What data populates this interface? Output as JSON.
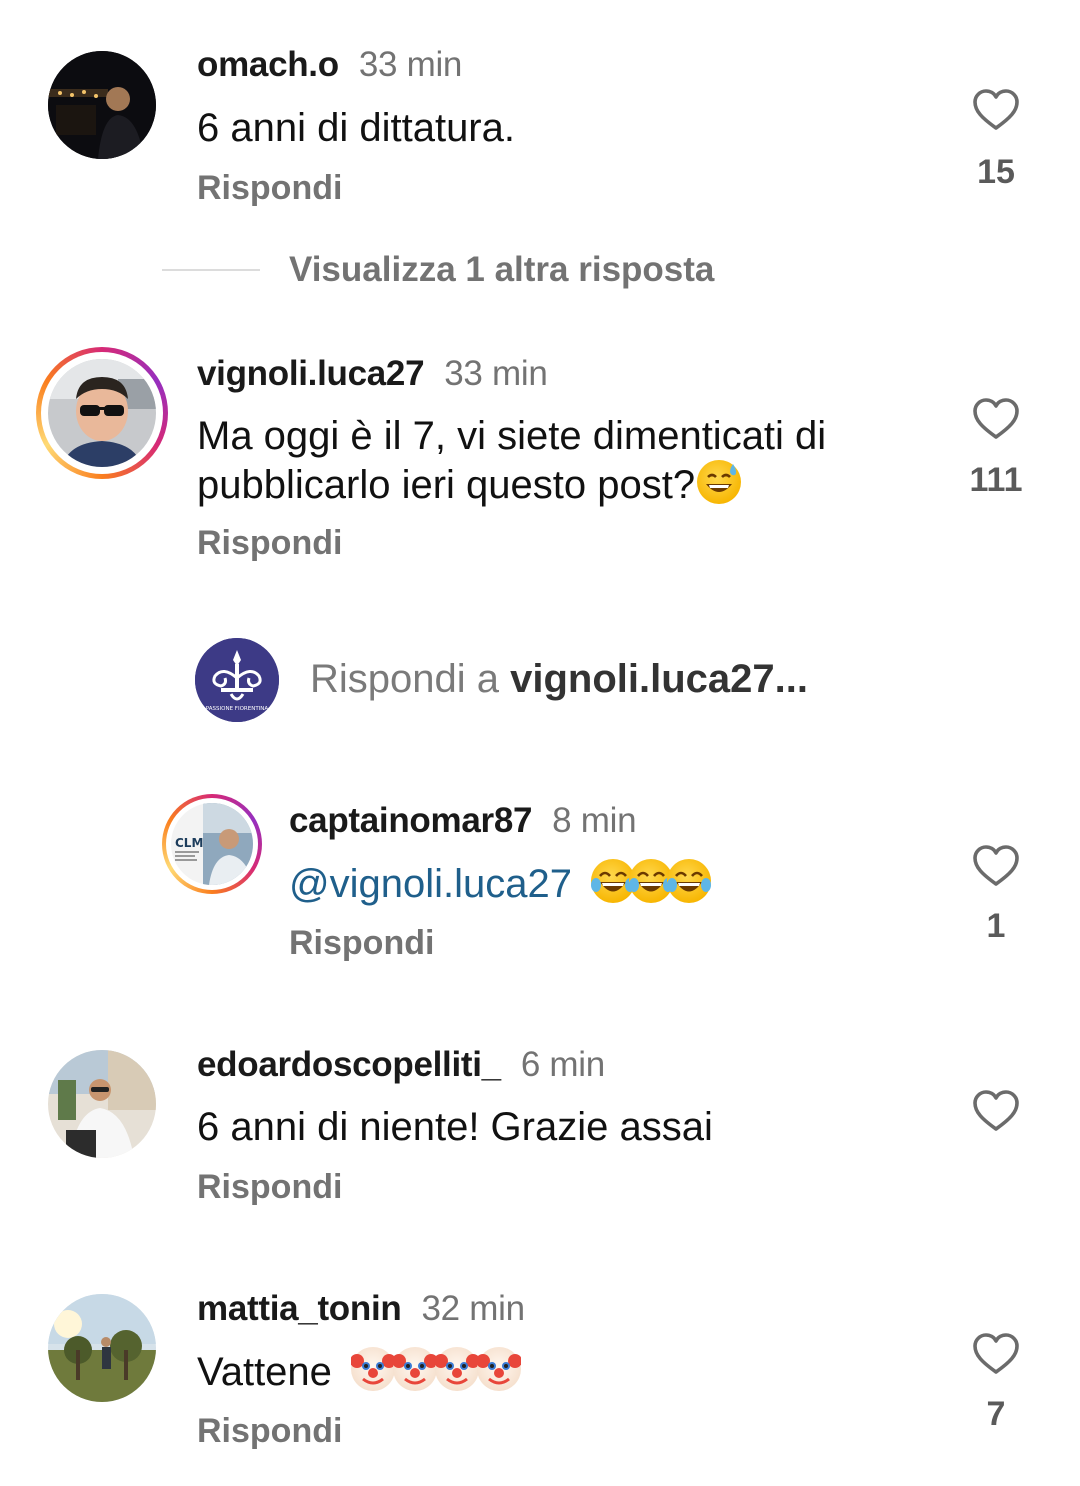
{
  "comments": [
    {
      "username": "omach.o",
      "time": "33 min",
      "text": "6 anni di dittatura.",
      "reply_label": "Rispondi",
      "likes": "15"
    },
    {
      "username": "vignoli.luca27",
      "time": "33 min",
      "text_line1": "Ma oggi è il 7, vi siete dimenticati di",
      "text_line2": "pubblicarlo ieri questo post?",
      "reply_label": "Rispondi",
      "likes": "111"
    },
    {
      "username": "edoardoscopelliti_",
      "time": "6 min",
      "text": "6 anni di niente! Grazie assai",
      "reply_label": "Rispondi"
    },
    {
      "username": "mattia_tonin",
      "time": "32 min",
      "text": "Vattene",
      "reply_label": "Rispondi",
      "likes": "7"
    }
  ],
  "view_more": "Visualizza 1 altra risposta",
  "reply_composer": {
    "prefix": "Rispondi a ",
    "target": "vignoli.luca27...",
    "avatar_caption": "PASSIONE FIORENTINA"
  },
  "nested_reply": {
    "username": "captainomar87",
    "time": "8 min",
    "mention": "@vignoli.luca27",
    "reply_label": "Rispondi",
    "likes": "1",
    "avatar_caption": "CLM"
  },
  "colors": {
    "secondary_text": "#737373",
    "mention": "#1f5f8b",
    "composer_avatar": "#3d3a86"
  },
  "icons": [
    "heart-outline-icon",
    "grinning-sweat-emoji",
    "tears-of-joy-emoji",
    "clown-face-emoji"
  ]
}
